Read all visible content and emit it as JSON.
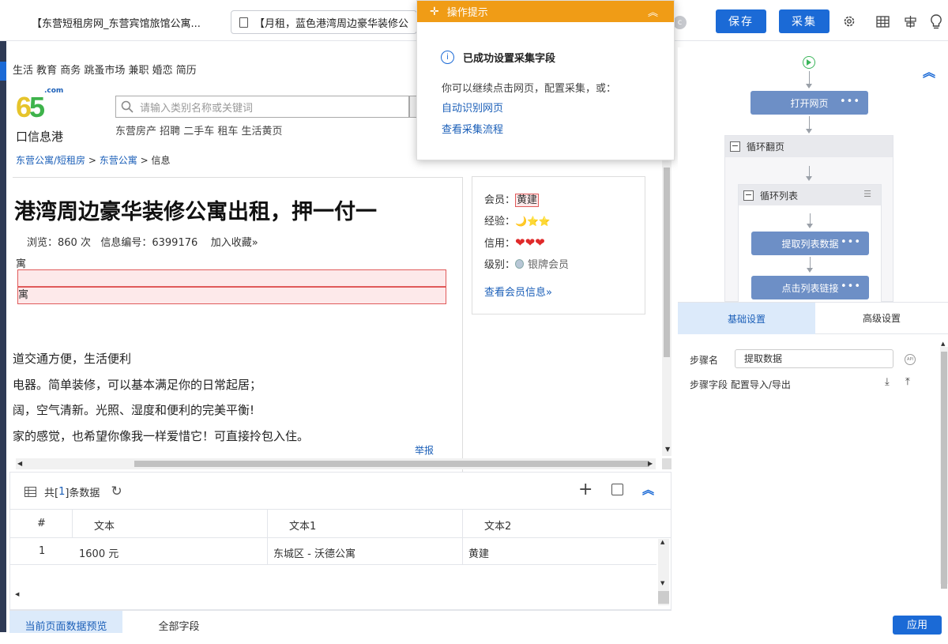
{
  "topbar": {
    "tab1": "【东营短租房网_东营宾馆旅馆公寓...",
    "tab2": "【月租，蓝色港湾周边豪华装修公",
    "save": "保存",
    "collect": "采集"
  },
  "site": {
    "nav_links": "生活 教育 商务 跳蚤市场 兼职 婚恋 简历",
    "logo_com": ".com",
    "logo_text": "口信息港",
    "search_placeholder": "请输入类别名称或关键词",
    "subnav": "东营房产 招聘 二手车 租车 生活黄页",
    "breadcrumb1": "东营公寓/短租房",
    "breadcrumb_sep1": " > ",
    "breadcrumb2": "东营公寓",
    "breadcrumb_sep2": " > ",
    "breadcrumb3": "信息",
    "title": "港湾周边豪华装修公寓出租，押一付一",
    "meta_views": "浏览：860 次",
    "meta_id": "信息编号：6399176",
    "meta_fav": "加入收藏»",
    "row1": "寓",
    "row3": "寓",
    "desc1": "道交通方便，生活便利",
    "desc2": "电器。简单装修，可以基本满足你的日常起居；",
    "desc3": "阔，空气清新。光照、湿度和便利的完美平衡!",
    "desc4": "家的感觉，也希望你像我一样爱惜它！可直接拎包入住。",
    "report": "举报"
  },
  "member": {
    "member_label": "会员：",
    "member_name": "黄建",
    "exp_label": "经验：",
    "exp_icons": "🌙⭐⭐",
    "credit_label": "信用：",
    "credit_icons": "❤❤❤",
    "level_label": "级别：",
    "level_value": "银牌会员",
    "view_info": "查看会员信息»"
  },
  "popup": {
    "title": "操作提示",
    "success": "已成功设置采集字段",
    "hint": "你可以继续点击网页，配置采集，或：",
    "link1": "自动识别网页",
    "link2": "查看采集流程"
  },
  "flow": {
    "open_page": "打开网页",
    "loop_page": "循环翻页",
    "loop_list": "循环列表",
    "extract": "提取列表数据",
    "click_link": "点击列表链接"
  },
  "settings": {
    "tab_basic": "基础设置",
    "tab_adv": "高级设置",
    "step_name_label": "步骤名",
    "step_name_value": "提取数据",
    "step_fields_label": "步骤字段",
    "step_fields_link": "配置导入/导出",
    "apply": "应用"
  },
  "datapanel": {
    "count_prefix": "共[",
    "count": "1",
    "count_suffix": "]条数据",
    "columns": [
      "#",
      "文本",
      "文本1",
      "文本2"
    ],
    "rows": [
      [
        "1",
        "1600 元",
        "东城区 - 沃德公寓",
        "黄建"
      ]
    ]
  },
  "bottomtabs": {
    "tab1": "当前页面数据预览",
    "tab2": "全部字段"
  }
}
